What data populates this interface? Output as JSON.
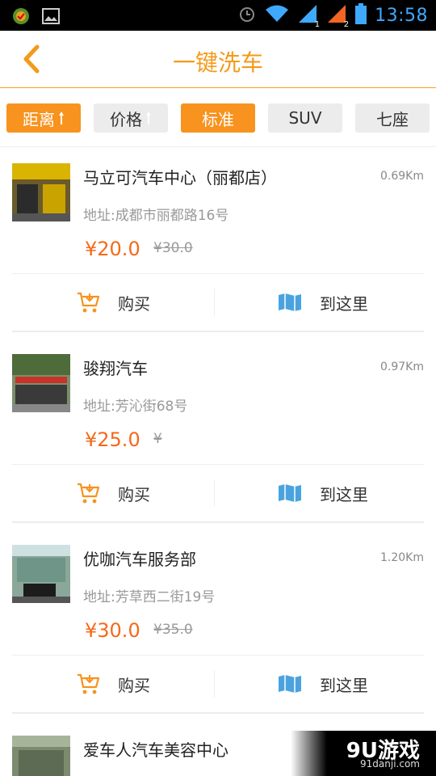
{
  "status_bar": {
    "time": "13:58",
    "sim1": "1",
    "sim2": "2"
  },
  "header": {
    "title": "一键洗车"
  },
  "filters": [
    {
      "label": "距离",
      "active": true,
      "sortable": true
    },
    {
      "label": "价格",
      "active": false,
      "sortable": true
    },
    {
      "label": "标准",
      "active": true,
      "sortable": false
    },
    {
      "label": "SUV",
      "active": false,
      "sortable": false
    },
    {
      "label": "七座",
      "active": false,
      "sortable": false
    }
  ],
  "actions": {
    "buy_label": "购买",
    "go_label": "到这里"
  },
  "shops": [
    {
      "name": "马立可汽车中心（丽都店）",
      "distance": "0.69Km",
      "address": "地址:成都市丽都路16号",
      "price": "¥20.0",
      "original_price": "¥30.0"
    },
    {
      "name": "骏翔汽车",
      "distance": "0.97Km",
      "address": "地址:芳沁街68号",
      "price": "¥25.0",
      "original_price": "¥"
    },
    {
      "name": "优咖汽车服务部",
      "distance": "1.20Km",
      "address": "地址:芳草西二街19号",
      "price": "¥30.0",
      "original_price": "¥35.0"
    },
    {
      "name": "爱车人汽车美容中心",
      "distance": "",
      "address": "",
      "price": "",
      "original_price": ""
    }
  ],
  "watermark": {
    "brand": "9U游戏",
    "site": "91danji.com"
  },
  "colors": {
    "accent": "#f7931e",
    "price": "#f5691a",
    "status_icons": "#3fa9ff"
  }
}
